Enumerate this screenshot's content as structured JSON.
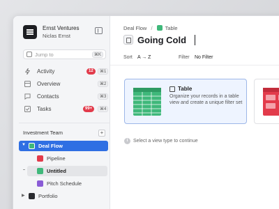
{
  "workspace": {
    "name": "Ernst Ventures",
    "user": "Niclas Ernst"
  },
  "jump": {
    "placeholder": "Jump to",
    "shortcut": "⌘K"
  },
  "nav": [
    {
      "label": "Activity",
      "badge": "12",
      "shortcut": "⌘1",
      "icon": "lightning-icon"
    },
    {
      "label": "Overview",
      "shortcut": "⌘2",
      "icon": "grid-icon"
    },
    {
      "label": "Contacts",
      "shortcut": "⌘3",
      "icon": "chat-icon"
    },
    {
      "label": "Tasks",
      "badge": "99+",
      "shortcut": "⌘4",
      "icon": "checkbox-icon"
    }
  ],
  "section": {
    "label": "Investment Team",
    "add": "+"
  },
  "tree": {
    "deal_flow": "Deal Flow",
    "pipeline": "Pipeline",
    "untitled": "Untitled",
    "pitch_schedule": "Pitch Schedule",
    "portfolio": "Portfolio"
  },
  "breadcrumb": {
    "parent": "Deal Flow",
    "sep": "/",
    "current": "Table"
  },
  "page": {
    "title": "Going Cold"
  },
  "filters": {
    "sort_label": "Sort",
    "sort_value": "A → Z",
    "filter_label": "Filter",
    "filter_value": "No Filter"
  },
  "cards": {
    "table": {
      "title": "Table",
      "desc": "Organize your records in a table view and create a unique filter set"
    }
  },
  "hint": "Select a view type to continue",
  "colors": {
    "accent": "#2f6fe3",
    "red": "#e23b4b",
    "green": "#3fb87a"
  }
}
